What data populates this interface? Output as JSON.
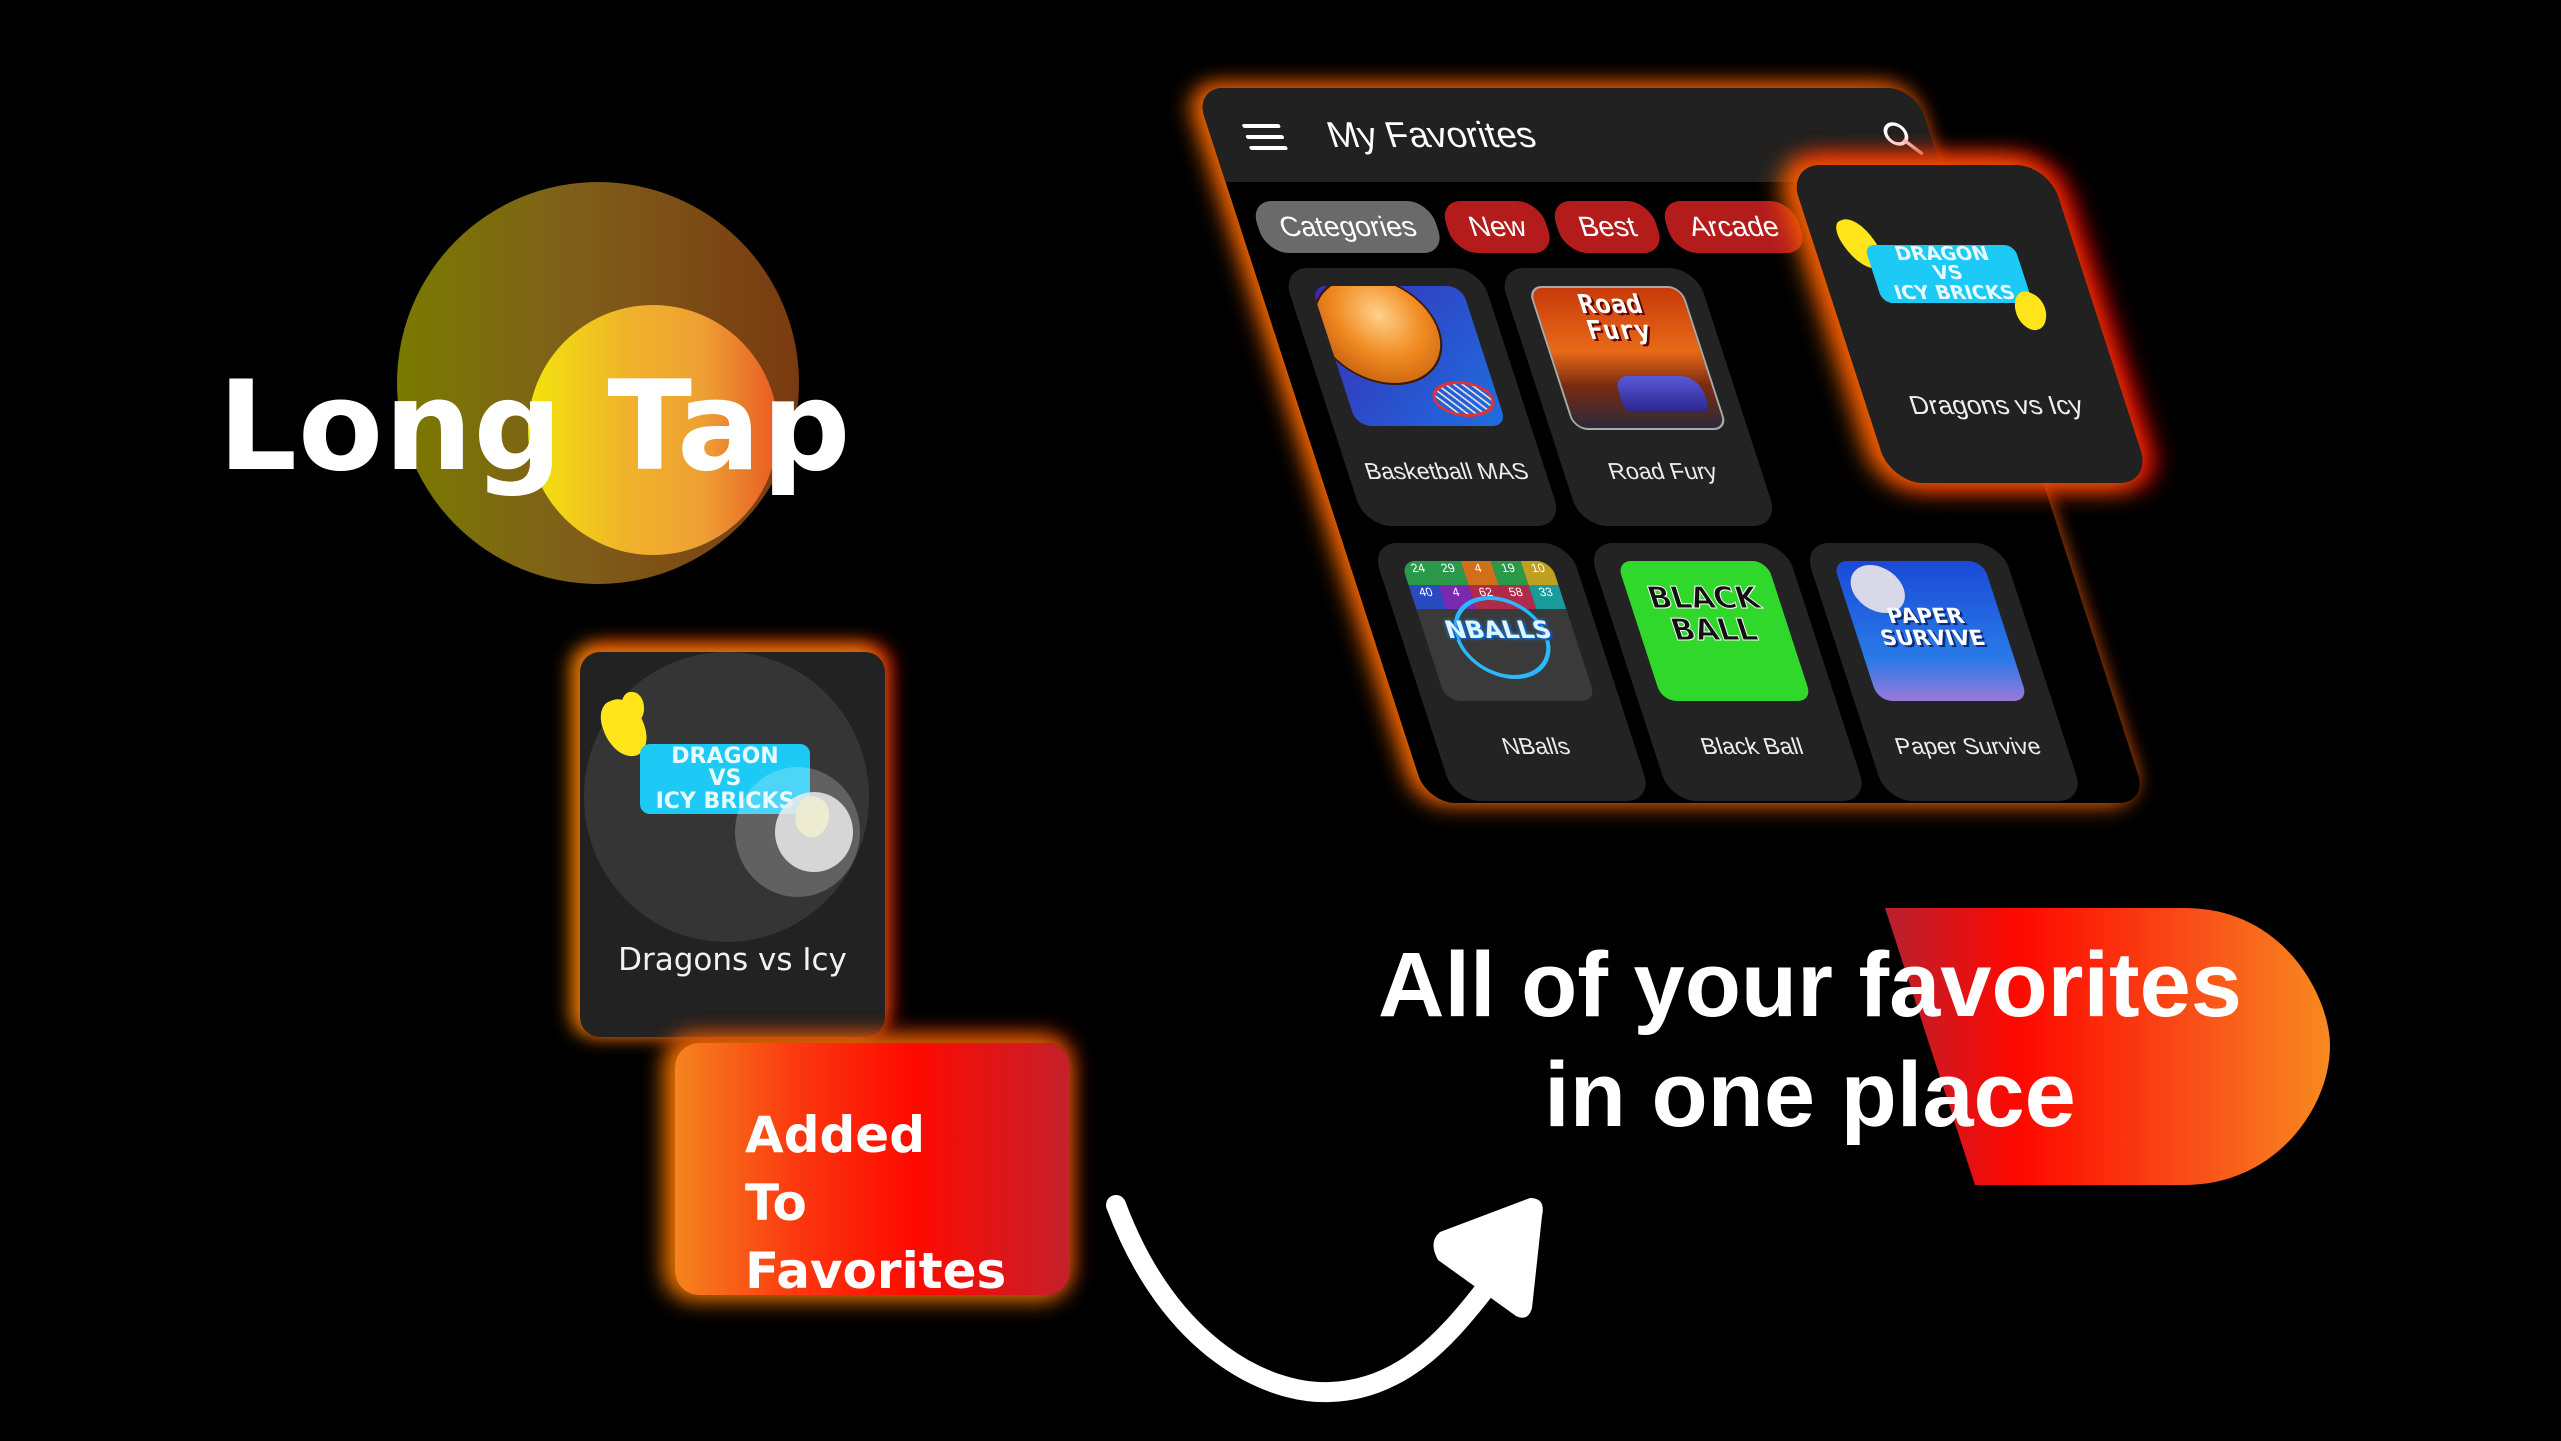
{
  "hero": {
    "long_tap_label": "Long Tap"
  },
  "tapped_card": {
    "logo_lines": [
      "DRAGON",
      "VS",
      "ICY BRICKS"
    ],
    "title": "Dragons vs Icy"
  },
  "toast": {
    "line1": "Added",
    "line2": "To Favorites"
  },
  "app": {
    "title": "My Favorites",
    "menu_icon": "hamburger-menu-icon",
    "search_icon": "search-icon",
    "chips": [
      {
        "label": "Categories",
        "active": true
      },
      {
        "label": "New",
        "active": false
      },
      {
        "label": "Best",
        "active": false
      },
      {
        "label": "Arcade",
        "active": false
      }
    ],
    "games": [
      {
        "title": "Basketball MAS",
        "thumb": "basketball-thumbnail"
      },
      {
        "title": "Road Fury",
        "thumb": "road-fury-thumbnail",
        "thumb_text": [
          "Road",
          "Fury"
        ]
      },
      {
        "title": "Dragons vs Icy",
        "thumb": "dragon-vs-icy-bricks-thumbnail",
        "highlighted": true
      },
      {
        "title": "NBalls",
        "thumb": "nballs-thumbnail",
        "thumb_text": "NBALLS",
        "grid_numbers": [
          "24",
          "29",
          "4",
          "19",
          "10",
          "40",
          "4",
          "62",
          "58",
          "33"
        ]
      },
      {
        "title": "Black Ball",
        "thumb": "black-ball-thumbnail",
        "thumb_text": [
          "BLACK",
          "BALL"
        ]
      },
      {
        "title": "Paper Survive",
        "thumb": "paper-survive-thumbnail",
        "thumb_text": [
          "PAPER",
          "SURVIVE"
        ]
      }
    ]
  },
  "highlighted_card": {
    "logo_lines": [
      "DRAGON",
      "VS",
      "ICY BRICKS"
    ],
    "title": "Dragons vs Icy"
  },
  "tagline": {
    "line1": "All of your favorites",
    "line2": "in one place"
  },
  "colors": {
    "accent_red": "#b41c1c",
    "chip_active": "#6a6a6a",
    "card_bg": "#232323",
    "appbar_bg": "#212121",
    "glow_orange": "#ff8c00",
    "glow_red": "#e60000",
    "logo_blue": "#1ccaf5",
    "dragon_yellow": "#ffe51a"
  }
}
